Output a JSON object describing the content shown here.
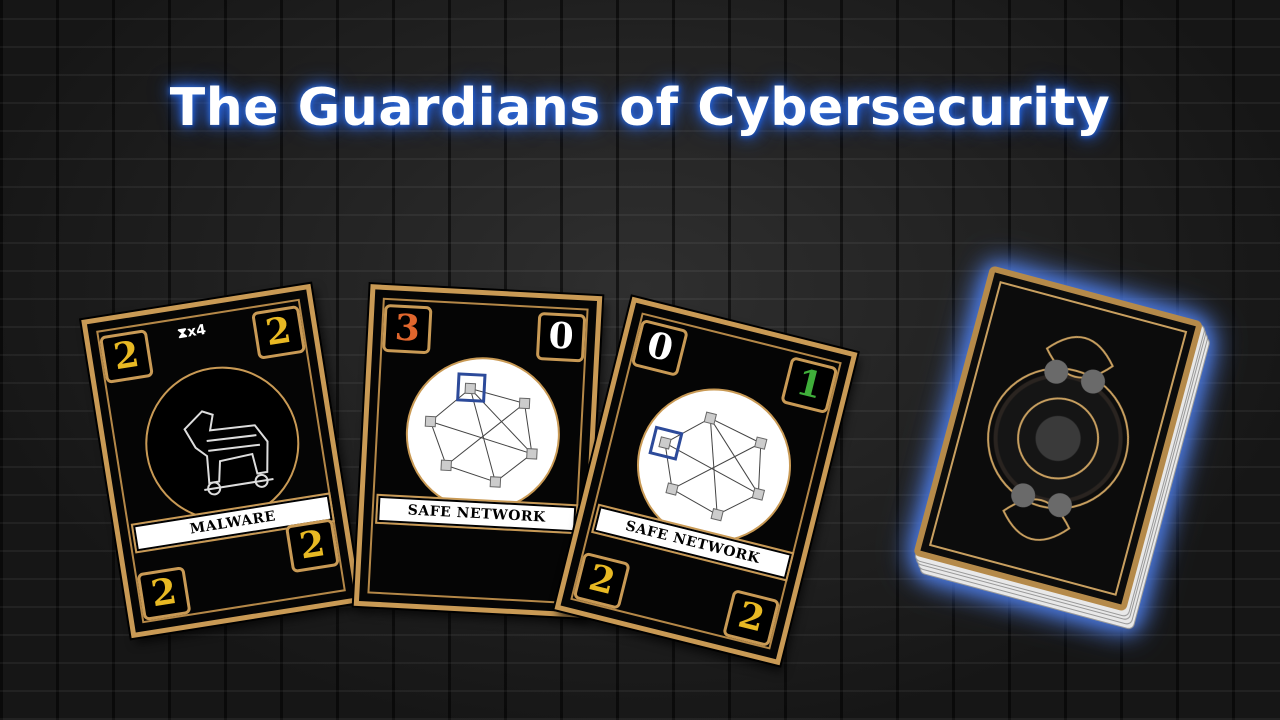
{
  "title": "The Guardians of Cybersecurity",
  "colors": {
    "title_glow": "#2a62d8",
    "card_border": "#c99a55",
    "number_gold": "#e8b923",
    "number_orange": "#e0662d",
    "number_green": "#3fae3a"
  },
  "cards": [
    {
      "name": "MALWARE",
      "timer": "x4",
      "top_left": "2",
      "top_right": "2",
      "bottom_left": "2",
      "bottom_right": "2",
      "image": "trojan-horse-icon"
    },
    {
      "name": "SAFE NETWORK",
      "top_left": "3",
      "top_right": "0",
      "image": "network-icon"
    },
    {
      "name": "SAFE NETWORK",
      "top_left": "0",
      "top_right": "1",
      "bottom_left": "2",
      "bottom_right": "2",
      "image": "network-icon"
    }
  ],
  "deck": {
    "image": "card-back-icon"
  }
}
